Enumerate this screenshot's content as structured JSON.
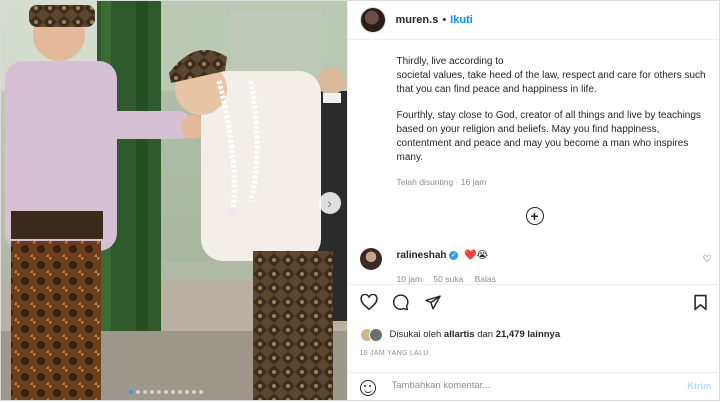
{
  "post": {
    "username": "muren.s",
    "separator": "•",
    "follow_label": "Ikuti",
    "caption_paragraphs": [
      "Thirdly, live according to\nsocietal values, take heed of the law, respect and care for others such that you can find peace and happiness in life.",
      "Fourthly, stay close to God, creator of all things and live by teachings based on your religion and beliefs. May you find happiness, contentment and peace and may you become a man who inspires many."
    ],
    "edited_label": "Telah disunting · 16 jam",
    "load_more_symbol": "+"
  },
  "comment": {
    "username": "ralineshah",
    "verified_symbol": "✓",
    "emojis": "❤️😭",
    "time": "10 jam",
    "likes": "50 suka",
    "reply_label": "Balas",
    "heart_icon": "♡"
  },
  "likes": {
    "prefix": "Disukai oleh",
    "user": "allartis",
    "suffix": "dan",
    "count": "21,479 lainnya"
  },
  "time_ago": "16 JAM YANG LALU",
  "comment_box": {
    "placeholder": "Tambahkan komentar...",
    "post_label": "Kirim"
  },
  "carousel": {
    "total_dots": 11,
    "active_index": 0,
    "next_symbol": "›"
  },
  "colors": {
    "accent": "#0095f6",
    "verified": "#3897f0",
    "muted": "#8e8e8e",
    "post_disabled": "#b3dbff"
  }
}
